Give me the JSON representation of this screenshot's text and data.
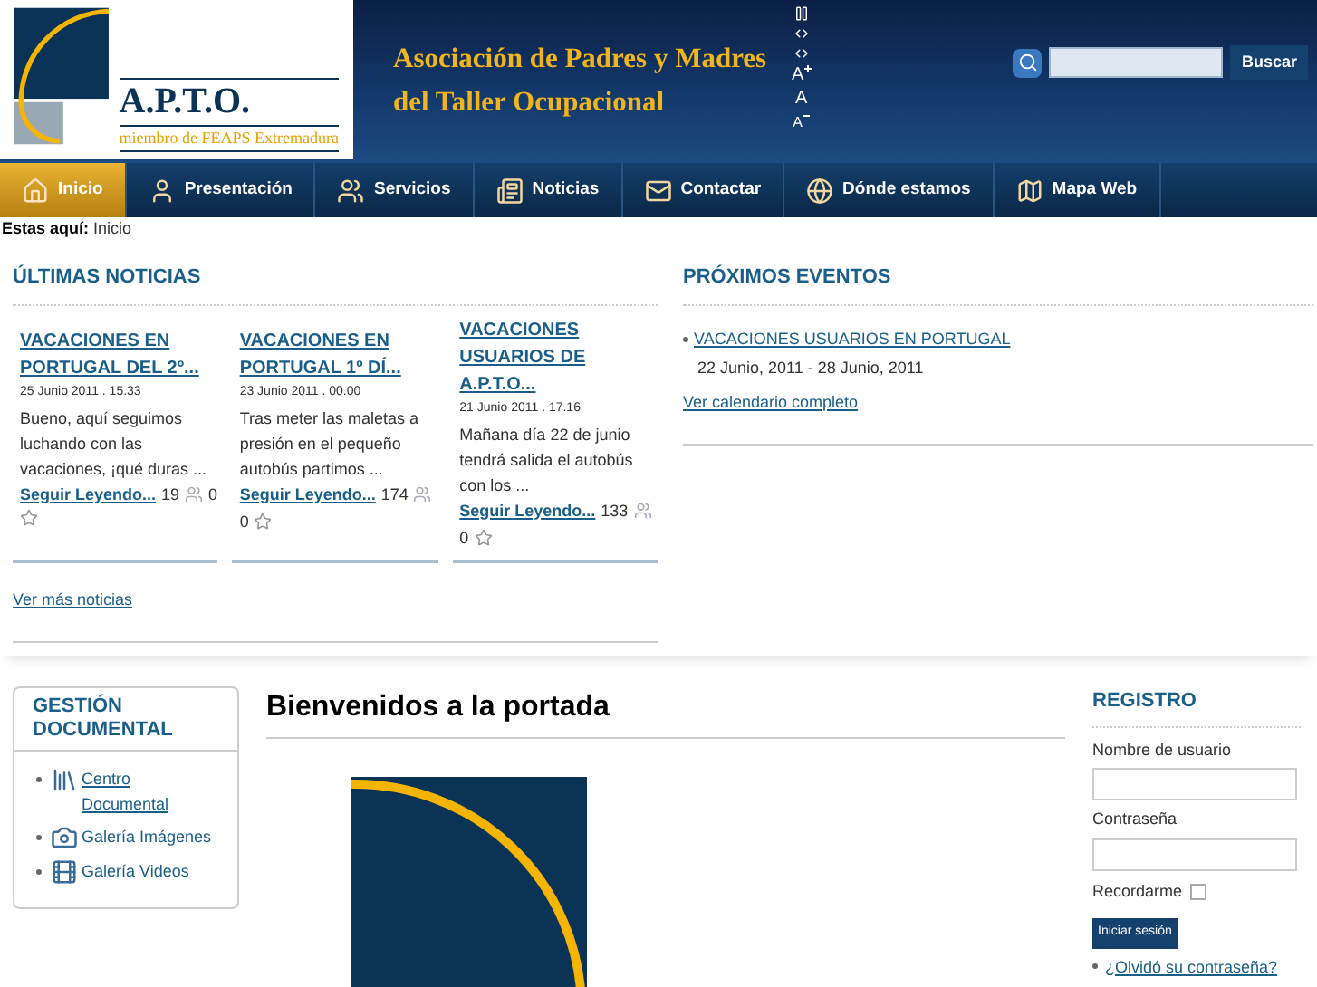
{
  "header": {
    "logo": {
      "name": "A.P.T.O.",
      "subtitle": "miembro de FEAPS Extremadura"
    },
    "title_lines": [
      "Asociación de Padres y Madres",
      "del Taller Ocupacional"
    ],
    "font_controls": [
      {
        "kind": "increase",
        "label": "A"
      },
      {
        "kind": "reset",
        "label": "A"
      },
      {
        "kind": "decrease",
        "label": "A"
      }
    ],
    "search": {
      "button": "Buscar"
    }
  },
  "nav": [
    {
      "label": "Inicio",
      "selected": true
    },
    {
      "label": "Presentación",
      "selected": false
    },
    {
      "label": "Servicios",
      "selected": false
    },
    {
      "label": "Noticias",
      "selected": false
    },
    {
      "label": "Contactar",
      "selected": false
    },
    {
      "label": "Dónde estamos",
      "selected": false
    },
    {
      "label": "Mapa Web",
      "selected": false
    }
  ],
  "breadcrumb": {
    "label": "Estas aquí:",
    "current": "Inicio"
  },
  "news": {
    "heading": "ÚLTIMAS NOTICIAS",
    "items": [
      {
        "title": "VACACIONES EN PORTUGAL DEL 2º...",
        "date": "25 Junio 2011 . 15.33",
        "excerpt": "Bueno, aquí seguimos luchando con las vacaciones, ¡qué duras ...",
        "link": "Seguir Leyendo...",
        "hits": "19",
        "votes": "0"
      },
      {
        "title": "VACACIONES EN PORTUGAL 1º DÍ...",
        "date": "23 Junio 2011 . 00.00",
        "excerpt": "Tras meter las maletas a presión en el pequeño autobús partimos ...",
        "link": "Seguir Leyendo...",
        "hits": "174",
        "votes": "0"
      },
      {
        "title": "VACACIONES USUARIOS DE A.P.T.O...",
        "date": "21 Junio 2011 . 17.16",
        "excerpt": "Mañana día 22 de junio tendrá salida el autobús con los ...",
        "link": "Seguir Leyendo...",
        "hits": "133",
        "votes": "0"
      }
    ],
    "more": "Ver más noticias"
  },
  "events": {
    "heading": "PRÓXIMOS EVENTOS",
    "items": [
      {
        "title": "VACACIONES USUARIOS EN PORTUGAL",
        "dates": "22 Junio, 2011 - 28 Junio, 2011"
      }
    ],
    "more": "Ver calendario completo"
  },
  "documents": {
    "heading": "GESTIÓN DOCUMENTAL",
    "items": [
      {
        "label": "Centro Documental"
      },
      {
        "label": "Galería Imágenes"
      },
      {
        "label": "Galería Videos"
      }
    ]
  },
  "main": {
    "heading": "Bienvenidos a la portada"
  },
  "login": {
    "heading": "REGISTRO",
    "username_label": "Nombre de usuario",
    "password_label": "Contraseña",
    "remember": {
      "label": "Recordarme",
      "checked": false
    },
    "button": "Iniciar sesión",
    "forgot": "¿Olvidó su contraseña?"
  }
}
